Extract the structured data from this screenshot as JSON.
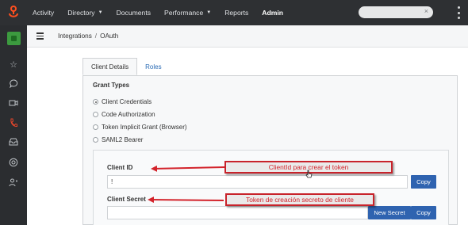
{
  "topnav": {
    "items": [
      {
        "label": "Activity",
        "caret": false,
        "active": false
      },
      {
        "label": "Directory",
        "caret": true,
        "active": false
      },
      {
        "label": "Documents",
        "caret": false,
        "active": false
      },
      {
        "label": "Performance",
        "caret": true,
        "active": false
      },
      {
        "label": "Reports",
        "caret": false,
        "active": false
      },
      {
        "label": "Admin",
        "caret": false,
        "active": true
      }
    ],
    "search_clear": "×",
    "caret_glyph": "▼"
  },
  "rail": {
    "icons": [
      "star-icon",
      "chat-icon",
      "video-icon",
      "phone-icon",
      "inbox-icon",
      "help-icon",
      "user-settings-icon"
    ],
    "glyphs": [
      "☆",
      "◯",
      "▭",
      "℘",
      "▭",
      "◎",
      "♙"
    ]
  },
  "breadcrumb": {
    "parent": "Integrations",
    "separator": "/",
    "current": "OAuth"
  },
  "tabs": {
    "client_details": "Client Details",
    "roles": "Roles"
  },
  "grant_types": {
    "title": "Grant Types",
    "options": [
      {
        "label": "Client Credentials",
        "selected": true
      },
      {
        "label": "Code Authorization",
        "selected": false
      },
      {
        "label": "Token Implicit Grant (Browser)",
        "selected": false
      },
      {
        "label": "SAML2 Bearer",
        "selected": false
      }
    ]
  },
  "client_id": {
    "label": "Client ID",
    "value": "!",
    "copy_label": "Copy"
  },
  "client_secret": {
    "label": "Client Secret",
    "value": "",
    "new_secret_label": "New Secret",
    "copy_label": "Copy"
  },
  "annotations": {
    "client_id_note": "ClientId para crear el token",
    "secret_note": "Token de creación secreto de cliente"
  },
  "colors": {
    "topbar": "#2e3033",
    "accent_blue": "#2f63b0",
    "link_blue": "#2a6bb5",
    "annotation_red": "#d3232b",
    "logo_orange": "#ff4f1f",
    "rail_green": "#3c9a3f"
  }
}
